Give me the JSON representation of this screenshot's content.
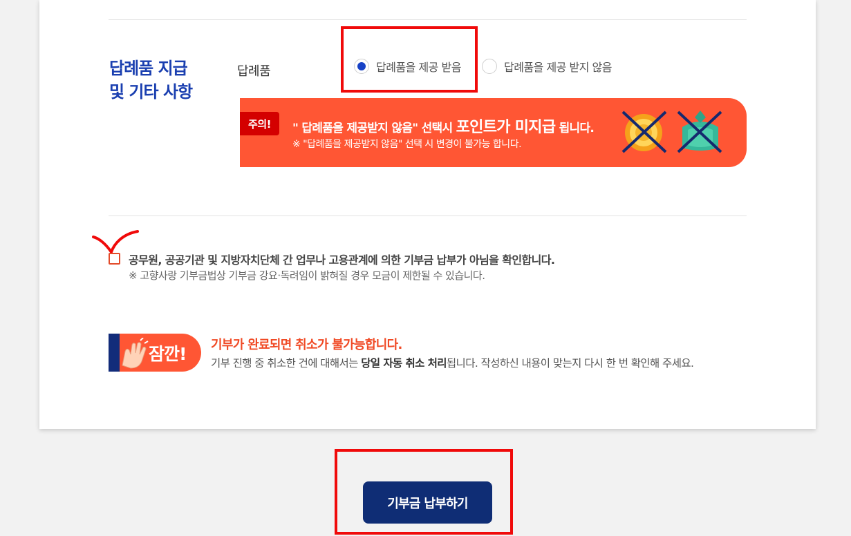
{
  "section": {
    "title": "답례품 지급\n및 기타 사항",
    "field_label": "답례품"
  },
  "gift_options": [
    {
      "label": "답례품을 제공 받음",
      "selected": true
    },
    {
      "label": "답례품을 제공 받지 않음",
      "selected": false
    }
  ],
  "notice": {
    "badge": "주의!",
    "line1_before": "\" 답례품을 제공받지 않음\" 선택시 ",
    "line1_emphasis": "포인트가 미지급",
    "line1_after": " 됩니다.",
    "line2": "※ \"답례품을 제공받지 않음\" 선택 시 변경이 불가능 합니다.",
    "icons": [
      "coin-crossed-icon",
      "gift-bundle-crossed-icon"
    ]
  },
  "confirmation": {
    "checked": false,
    "text": "공무원, 공공기관 및 지방자치단체 간 업무나 고용관계에 의한 기부금 납부가 아님을 확인합니다.",
    "note": "※ 고향사랑 기부금법상 기부금 강요·독려임이 밝혀질 경우 모금이 제한될 수 있습니다."
  },
  "wait": {
    "badge": "잠깐!",
    "title": "기부가 완료되면 취소가 불가능합니다.",
    "desc_before": "기부 진행 중 취소한 건에 대해서는 ",
    "desc_bold": "당일 자동 취소 처리",
    "desc_after": "됩니다. 작성하신 내용이 맞는지 다시 한 번 확인해 주세요."
  },
  "submit": {
    "label": "기부금 납부하기"
  },
  "colors": {
    "accent_blue": "#1a3fb0",
    "notice_orange": "#ff5634",
    "navy_button": "#0f2d75",
    "highlight_red": "#f00a0a"
  }
}
